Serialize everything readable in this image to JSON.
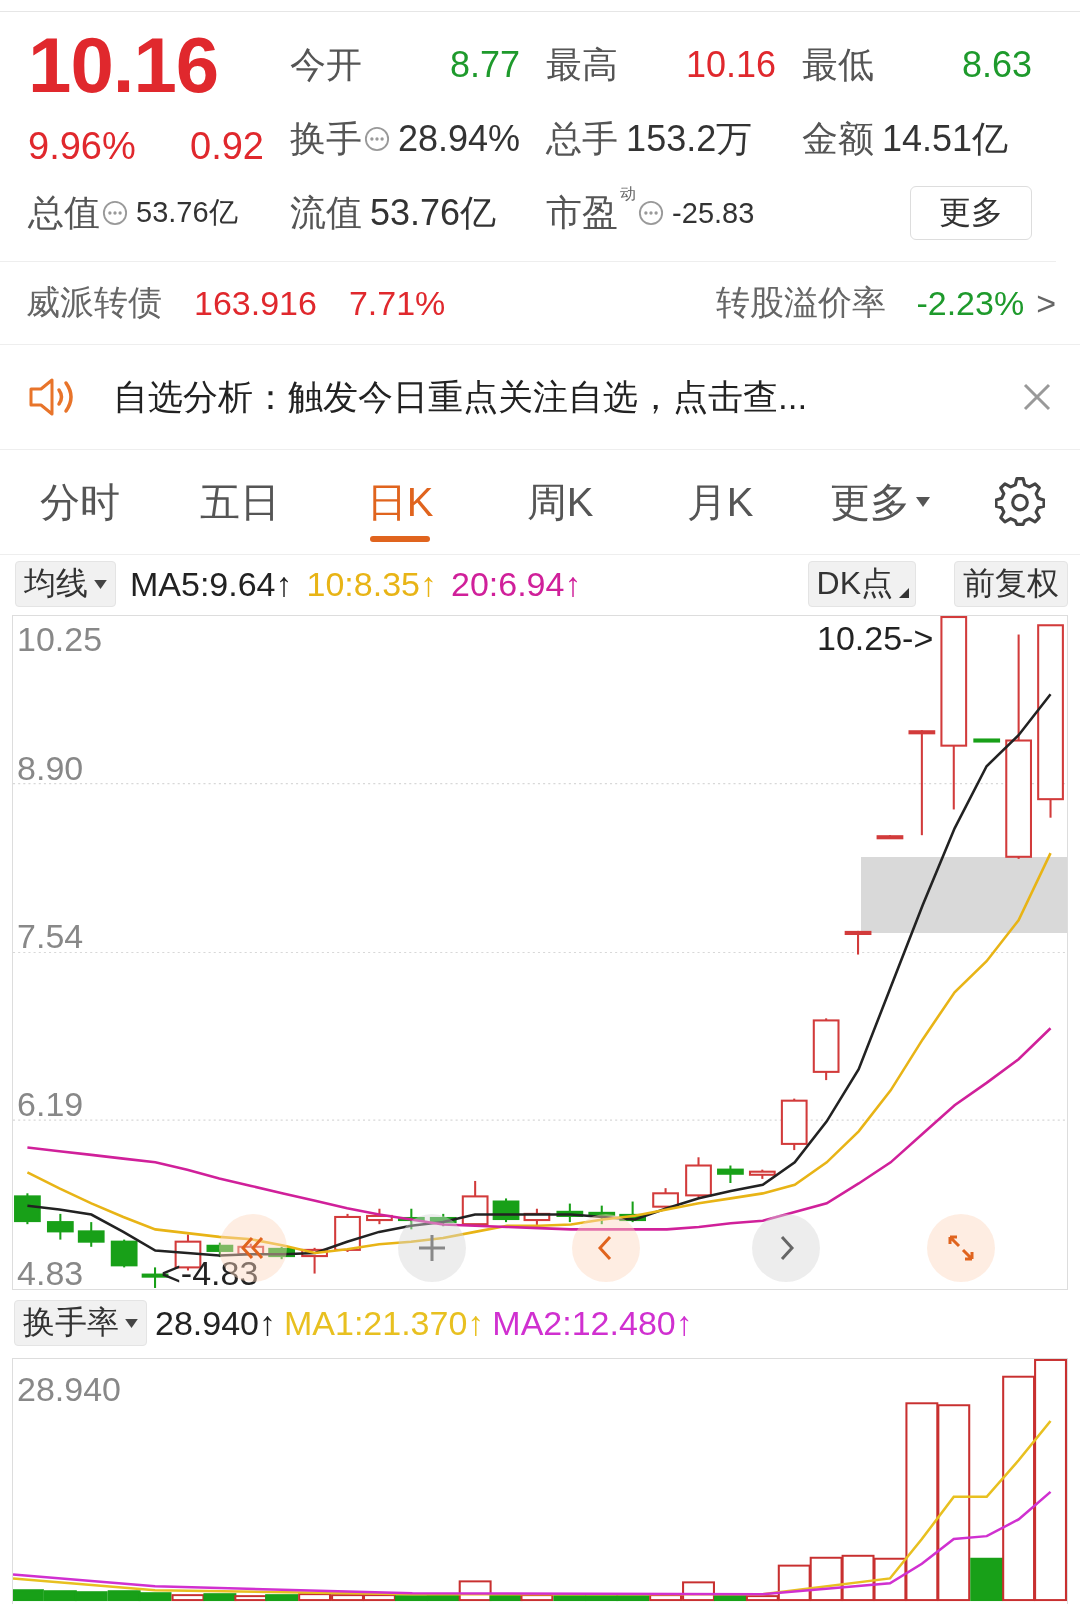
{
  "quote": {
    "price": "10.16",
    "change_pct": "9.96%",
    "change": "0.92",
    "color": "#e0282d",
    "stats": [
      {
        "label": "今开",
        "value": "8.77",
        "color": "#1e9a2c"
      },
      {
        "label": "最高",
        "value": "10.16",
        "color": "#e0282d"
      },
      {
        "label": "最低",
        "value": "8.63",
        "color": "#1e9a2c"
      },
      {
        "label": "换手",
        "value": "28.94%",
        "color": "#333333",
        "info": true
      },
      {
        "label": "总手",
        "value": "153.2万",
        "color": "#333333"
      },
      {
        "label": "金额",
        "value": "14.51亿",
        "color": "#333333"
      },
      {
        "label": "总值",
        "value": "53.76亿",
        "color": "#333333",
        "info": true
      },
      {
        "label": "流值",
        "value": "53.76亿",
        "color": "#333333"
      },
      {
        "label": "市盈",
        "sup": "动",
        "value": "-25.83",
        "color": "#333333",
        "info": true
      }
    ],
    "more_button": "更多"
  },
  "bond": {
    "name": "威派转债",
    "price": "163.916",
    "change": "7.71%",
    "color": "#e0282d",
    "premium_label": "转股溢价率",
    "premium": {
      "text": "-2.23%",
      "color": "#1e9a2c"
    },
    "arrow": ">"
  },
  "notice": {
    "text": "自选分析：触发今日重点关注自选，点击查..."
  },
  "tabs": [
    {
      "label": "分时",
      "selected": false,
      "kind": "tab"
    },
    {
      "label": "五日",
      "selected": false,
      "kind": "tab"
    },
    {
      "label": "日K",
      "selected": true,
      "kind": "tab"
    },
    {
      "label": "周K",
      "selected": false,
      "kind": "tab"
    },
    {
      "label": "月K",
      "selected": false,
      "kind": "tab"
    },
    {
      "label": "更多",
      "selected": false,
      "kind": "dropdown"
    }
  ],
  "indicator_bar": {
    "selector": "均线",
    "dk_button": "DK点",
    "adjust_button": "前复权"
  },
  "price_chart": {
    "top_label": "10.25",
    "high_marker": "10.25->",
    "low_marker": "<-4.83",
    "chart_data": {
      "type": "line",
      "grid": true,
      "ylim": [
        4.83,
        10.25
      ],
      "yticks": [
        {
          "value": 8.9,
          "label": "8.90"
        },
        {
          "value": 7.54,
          "label": "7.54"
        },
        {
          "value": 6.19,
          "label": "6.19"
        },
        {
          "value": 4.83,
          "label": "4.83"
        }
      ],
      "series": [
        {
          "name": "MA5:9.64↑",
          "color": "#222222",
          "values": [
            5.5,
            5.47,
            5.43,
            5.29,
            5.14,
            5.12,
            5.1,
            5.11,
            5.11,
            5.12,
            5.21,
            5.29,
            5.34,
            5.37,
            5.43,
            5.43,
            5.43,
            5.43,
            5.41,
            5.39,
            5.48,
            5.56,
            5.62,
            5.67,
            5.85,
            6.18,
            6.6,
            7.26,
            7.92,
            8.54,
            9.04,
            9.29,
            9.62
          ]
        },
        {
          "name": "10:8.35↑",
          "color": "#e8b416",
          "values": [
            5.77,
            5.64,
            5.52,
            5.41,
            5.31,
            5.28,
            5.25,
            5.23,
            5.18,
            5.12,
            5.15,
            5.19,
            5.21,
            5.24,
            5.29,
            5.34,
            5.34,
            5.35,
            5.39,
            5.42,
            5.47,
            5.52,
            5.56,
            5.6,
            5.67,
            5.85,
            6.1,
            6.43,
            6.84,
            7.22,
            7.47,
            7.8,
            8.34
          ]
        },
        {
          "name": "20:6.94↑",
          "color": "#d0209a",
          "values": [
            5.97,
            5.94,
            5.91,
            5.88,
            5.85,
            5.79,
            5.72,
            5.66,
            5.6,
            5.54,
            5.48,
            5.43,
            5.39,
            5.35,
            5.34,
            5.33,
            5.32,
            5.31,
            5.31,
            5.31,
            5.31,
            5.33,
            5.36,
            5.38,
            5.45,
            5.52,
            5.68,
            5.85,
            6.08,
            6.31,
            6.49,
            6.68,
            6.93
          ]
        }
      ]
    }
  },
  "volume_bar": {
    "selector": "换手率",
    "values": [
      {
        "text": "28.940↑",
        "color": "#222222"
      },
      {
        "text": "MA1:21.370↑",
        "color": "#e8c020"
      },
      {
        "text": "MA2:12.480↑",
        "color": "#d030d0"
      }
    ]
  },
  "volume_chart": {
    "y_label": "28.940"
  }
}
